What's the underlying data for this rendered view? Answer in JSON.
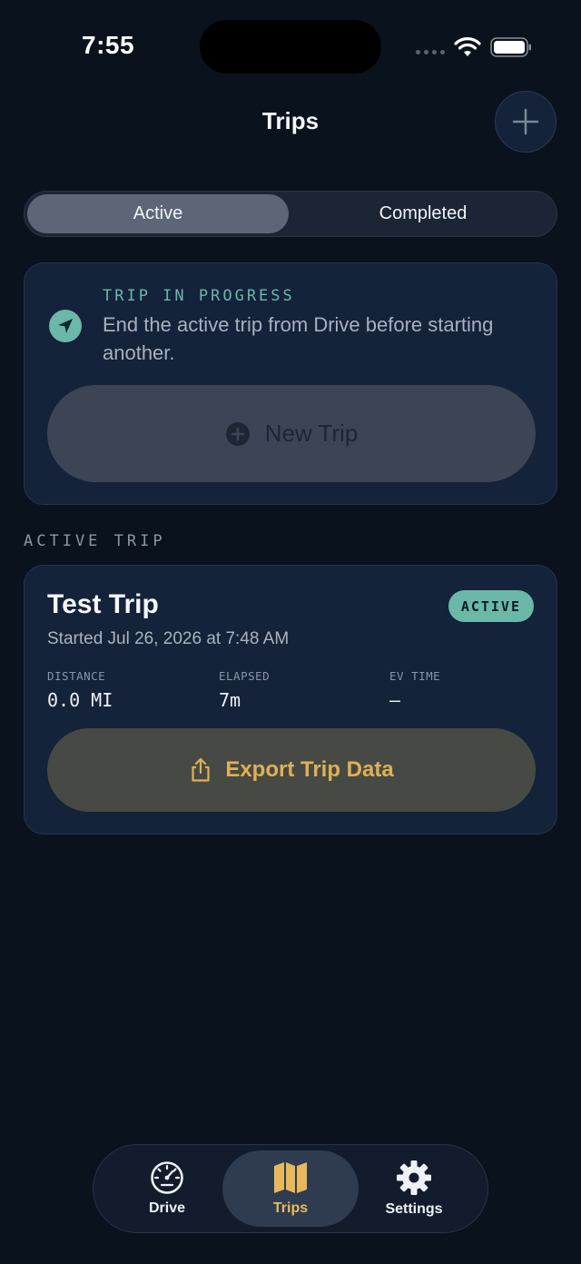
{
  "status_bar": {
    "time": "7:55"
  },
  "header": {
    "title": "Trips"
  },
  "segmented": {
    "active_label": "Active",
    "completed_label": "Completed"
  },
  "progress_card": {
    "kicker": "TRIP IN PROGRESS",
    "message": "End the active trip from Drive before starting another.",
    "new_trip_label": "New Trip"
  },
  "section": {
    "title": "ACTIVE TRIP"
  },
  "active_trip": {
    "name": "Test Trip",
    "badge": "ACTIVE",
    "started": "Started Jul 26, 2026 at 7:48 AM",
    "stats": [
      {
        "label": "DISTANCE",
        "value": "0.0 MI"
      },
      {
        "label": "ELAPSED",
        "value": "7m"
      },
      {
        "label": "EV TIME",
        "value": "–"
      }
    ],
    "export_label": "Export Trip Data"
  },
  "tab_bar": {
    "tabs": [
      {
        "label": "Drive",
        "icon": "speedometer-icon"
      },
      {
        "label": "Trips",
        "icon": "map-icon"
      },
      {
        "label": "Settings",
        "icon": "gear-icon"
      }
    ],
    "selected": "Trips"
  },
  "colors": {
    "background": "#0a121d",
    "accent_teal": "#6cb8a8",
    "accent_gold": "#e0b057",
    "card": "#14223a"
  }
}
